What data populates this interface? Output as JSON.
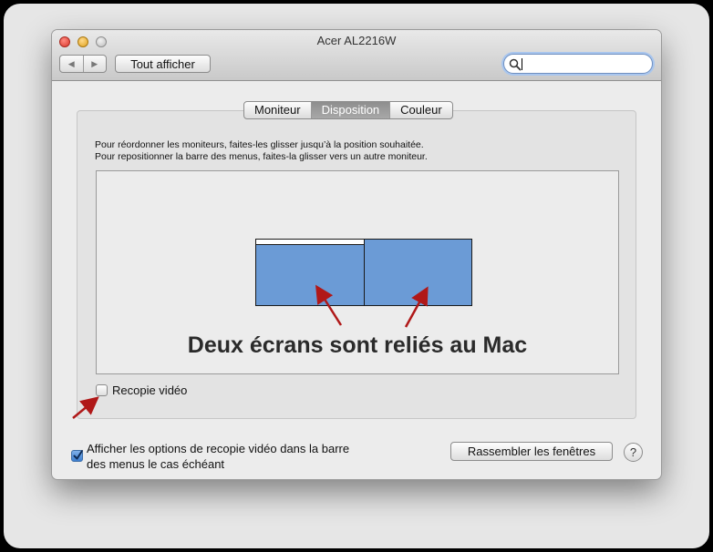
{
  "window": {
    "title": "Acer AL2216W",
    "nav": {
      "back_symbol": "◀",
      "forward_symbol": "▶"
    },
    "show_all_label": "Tout afficher",
    "search": {
      "value": "",
      "placeholder": ""
    }
  },
  "tabs": [
    {
      "label": "Moniteur",
      "active": false
    },
    {
      "label": "Disposition",
      "active": true
    },
    {
      "label": "Couleur",
      "active": false
    }
  ],
  "instructions": {
    "line1": "Pour réordonner les moniteurs, faites-les glisser jusqu’à la position souhaitée.",
    "line2": "Pour repositionner la barre des menus, faites-la glisser vers un autre moniteur."
  },
  "arrangement": {
    "annotation": "Deux écrans sont reliés au Mac",
    "monitor_color": "#6b9bd6"
  },
  "mirror": {
    "label": "Recopie vidéo",
    "checked": false
  },
  "menu_option": {
    "line1": "Afficher les options de recopie vidéo dans la barre",
    "line2": "des menus le cas échéant",
    "checked": true
  },
  "gather_button_label": "Rassembler les fenêtres",
  "help_label": "?",
  "colors": {
    "annotation_arrow": "#b01818",
    "accent": "#3d7fd0"
  }
}
